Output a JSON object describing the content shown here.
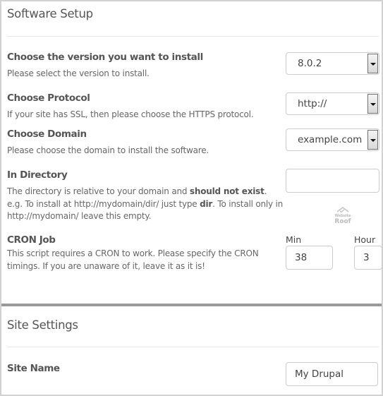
{
  "software_setup": {
    "title": "Software Setup",
    "version": {
      "label": "Choose the version you want to install",
      "description": "Please select the version to install.",
      "selected": "8.0.2"
    },
    "protocol": {
      "label": "Choose Protocol",
      "description": "If your site has SSL, then please choose the HTTPS protocol.",
      "selected": "http://"
    },
    "domain": {
      "label": "Choose Domain",
      "description": "Please choose the domain to install the software.",
      "selected": "example.com"
    },
    "directory": {
      "label": "In Directory",
      "desc_part1": "The directory is relative to your domain and ",
      "desc_bold1": "should not exist",
      "desc_part2": ". e.g. To install at http://mydomain/dir/ just type ",
      "desc_bold2": "dir",
      "desc_part3": ". To install only in http://mydomain/ leave this empty.",
      "value": ""
    },
    "watermark": {
      "line1": "Website",
      "line2": "Roof"
    },
    "cron": {
      "label": "CRON Job",
      "description": "This script requires a CRON to work. Please specify the CRON timings. If you are unaware of it, leave it as it is!",
      "min_label": "Min",
      "min_value": "38",
      "hour_label": "Hour",
      "hour_value": "3"
    }
  },
  "site_settings": {
    "title": "Site Settings",
    "site_name": {
      "label": "Site Name",
      "value": "My Drupal"
    }
  }
}
